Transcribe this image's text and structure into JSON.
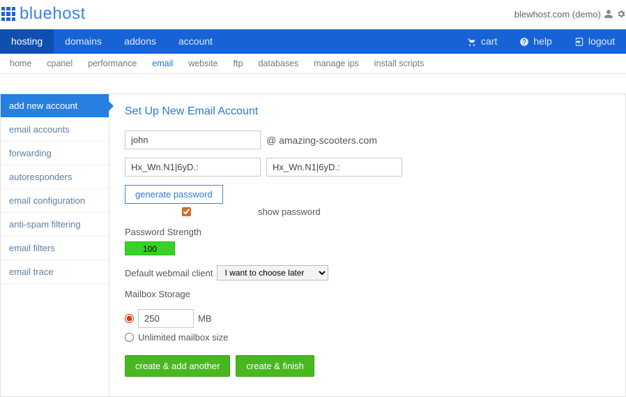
{
  "header": {
    "brand": "bluehost",
    "account_label": "blewhost.com (demo)"
  },
  "nav": {
    "items": [
      "hosting",
      "domains",
      "addons",
      "account"
    ],
    "active": 0,
    "right": {
      "cart": "cart",
      "help": "help",
      "logout": "logout"
    }
  },
  "subnav": {
    "items": [
      "home",
      "cpanel",
      "performance",
      "email",
      "website",
      "ftp",
      "databases",
      "manage ips",
      "install scripts"
    ],
    "active": 3
  },
  "sidebar": {
    "items": [
      "add new account",
      "email accounts",
      "forwarding",
      "autoresponders",
      "email configuration",
      "anti-spam filtering",
      "email filters",
      "email trace"
    ],
    "active": 0
  },
  "form": {
    "title": "Set Up New Email Account",
    "username": "john",
    "domain": "@ amazing-scooters.com",
    "password": "Hx_Wn.N1|6yD.:",
    "password_confirm": "Hx_Wn.N1|6yD.:",
    "generate_btn": "generate password",
    "show_password_checked": true,
    "show_password_label": "show password",
    "strength_label": "Password Strength",
    "strength_value": "100",
    "webmail_label": "Default webmail client",
    "webmail_options": [
      "I want to choose later"
    ],
    "webmail_selected": "I want to choose later",
    "storage_label": "Mailbox Storage",
    "storage_fixed": "250",
    "storage_unit": "MB",
    "storage_unlimited": "Unlimited mailbox size",
    "storage_choice": "fixed",
    "buttons": {
      "add_another": "create & add another",
      "finish": "create & finish"
    }
  }
}
